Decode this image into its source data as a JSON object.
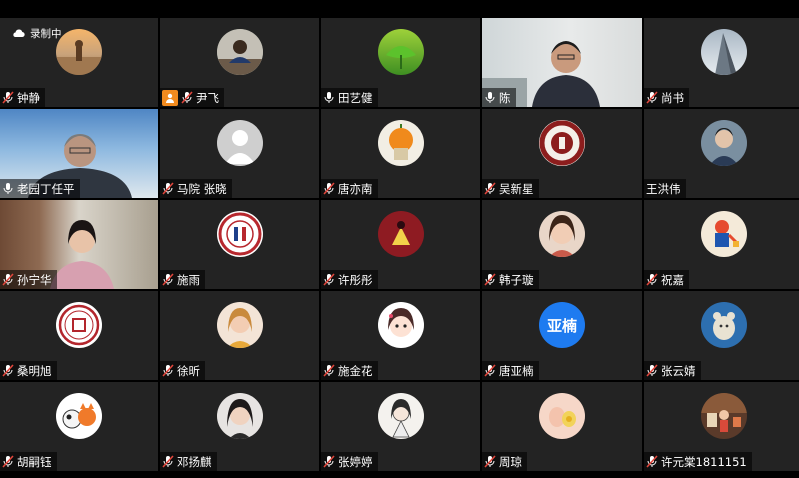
{
  "recording": {
    "label": "录制中",
    "icon": "cloud-icon"
  },
  "participants": [
    {
      "name": "钟静",
      "mic": "muted",
      "avatar_type": "photo",
      "avatar": "desert-scene"
    },
    {
      "name": "尹飞",
      "mic": "muted",
      "host": true,
      "avatar_type": "photo",
      "avatar": "person-at-desk"
    },
    {
      "name": "田艺健",
      "mic": "on",
      "avatar_type": "photo",
      "avatar": "green-leaf"
    },
    {
      "name": "陈",
      "mic": "on",
      "active_speaker": true,
      "avatar_type": "video",
      "avatar": "man-in-office"
    },
    {
      "name": "尚书",
      "mic": "muted",
      "avatar_type": "photo",
      "avatar": "building-sky"
    },
    {
      "name": "老园丁任平",
      "mic": "on",
      "avatar_type": "video",
      "avatar": "man-with-glasses"
    },
    {
      "name": "马院 张晓",
      "mic": "muted",
      "avatar_type": "default",
      "avatar": "default-user"
    },
    {
      "name": "唐亦南",
      "mic": "muted",
      "avatar_type": "photo",
      "avatar": "orange-plant"
    },
    {
      "name": "吴新星",
      "mic": "muted",
      "avatar_type": "photo",
      "avatar": "university-seal"
    },
    {
      "name": "王洪伟",
      "mic": "none",
      "avatar_type": "photo",
      "avatar": "person-blue"
    },
    {
      "name": "孙宁华",
      "mic": "muted",
      "avatar_type": "video",
      "avatar": "woman-in-office"
    },
    {
      "name": "施雨",
      "mic": "muted",
      "avatar_type": "photo",
      "avatar": "school-emblem"
    },
    {
      "name": "许彤彤",
      "mic": "muted",
      "avatar_type": "photo",
      "avatar": "dark-red-figure"
    },
    {
      "name": "韩子璇",
      "mic": "muted",
      "avatar_type": "photo",
      "avatar": "girl-portrait"
    },
    {
      "name": "祝嘉",
      "mic": "muted",
      "avatar_type": "photo",
      "avatar": "cartoon-figure"
    },
    {
      "name": "桑明旭",
      "mic": "muted",
      "avatar_type": "photo",
      "avatar": "seal-stamp"
    },
    {
      "name": "徐昕",
      "mic": "muted",
      "avatar_type": "photo",
      "avatar": "woman-portrait"
    },
    {
      "name": "施金花",
      "mic": "muted",
      "avatar_type": "photo",
      "avatar": "anime-girl"
    },
    {
      "name": "唐亚楠",
      "mic": "muted",
      "avatar_type": "text",
      "avatar_text": "亚楠",
      "avatar_color": "#1e7bf0"
    },
    {
      "name": "张云婧",
      "mic": "muted",
      "avatar_type": "photo",
      "avatar": "cartoon-cat"
    },
    {
      "name": "胡嗣钰",
      "mic": "muted",
      "avatar_type": "photo",
      "avatar": "cartoon-animals"
    },
    {
      "name": "邓扬麒",
      "mic": "muted",
      "avatar_type": "photo",
      "avatar": "woman-portrait-2"
    },
    {
      "name": "张婷婷",
      "mic": "muted",
      "avatar_type": "photo",
      "avatar": "girl-sketch"
    },
    {
      "name": "周琼",
      "mic": "muted",
      "avatar_type": "photo",
      "avatar": "baby-hands"
    },
    {
      "name": "许元棠1811151",
      "mic": "muted",
      "avatar_type": "photo",
      "avatar": "street-scene"
    }
  ],
  "colors": {
    "tile_bg": "#232323",
    "active_border": "#23d959",
    "muted_icon": "#e0463c",
    "host_badge": "#f38b1e"
  }
}
